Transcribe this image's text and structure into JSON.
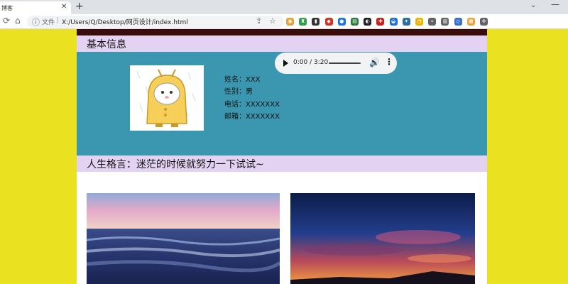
{
  "browser": {
    "tab_title": "博客",
    "tab_close": "✕",
    "new_tab": "+",
    "tab_list": "⌄",
    "minimize": "—",
    "file_label": "文件",
    "separator": "|",
    "url": "X:/Users/Q/Desktop/网页设计/index.html",
    "extensions": [
      {
        "name": "extension-1",
        "color": "#e8a23a"
      },
      {
        "name": "extension-2",
        "color": "#2e9e48"
      },
      {
        "name": "extension-3",
        "color": "#333333"
      },
      {
        "name": "extension-4",
        "color": "#d93025"
      },
      {
        "name": "extension-5",
        "color": "#1a73e8"
      },
      {
        "name": "extension-6",
        "color": "#2c7a3e"
      },
      {
        "name": "extension-7",
        "color": "#202124"
      },
      {
        "name": "extension-8",
        "color": "#c5221f"
      },
      {
        "name": "extension-9",
        "color": "#1e6fd9"
      },
      {
        "name": "extension-10",
        "color": "#2a6fa8"
      },
      {
        "name": "extension-11",
        "color": "#f0b400"
      },
      {
        "name": "extension-12",
        "color": "#5f6368"
      },
      {
        "name": "extension-13",
        "color": "#5f6368"
      },
      {
        "name": "extension-14",
        "color": "#3b6fd0"
      },
      {
        "name": "extension-15",
        "color": "#e8a23a"
      },
      {
        "name": "extension-16",
        "color": "#5f6368"
      }
    ]
  },
  "page": {
    "basic_info_heading": "基本信息",
    "fields": [
      {
        "label": "姓名：",
        "value": "XXX"
      },
      {
        "label": "性别：",
        "value": "男"
      },
      {
        "label": "电话：",
        "value": "XXXXXXX"
      },
      {
        "label": "邮箱：",
        "value": "XXXXXXX"
      }
    ],
    "motto": "人生格言：迷茫的时候就努力一下试试~"
  },
  "audio": {
    "current_time": "0:00",
    "divider": "/",
    "duration": "3:20",
    "progress": 0
  },
  "colors": {
    "page_background": "#eae221",
    "top_bar": "#3a0c0a",
    "section_header": "#e3d2f2",
    "info_panel": "#3b97af"
  }
}
